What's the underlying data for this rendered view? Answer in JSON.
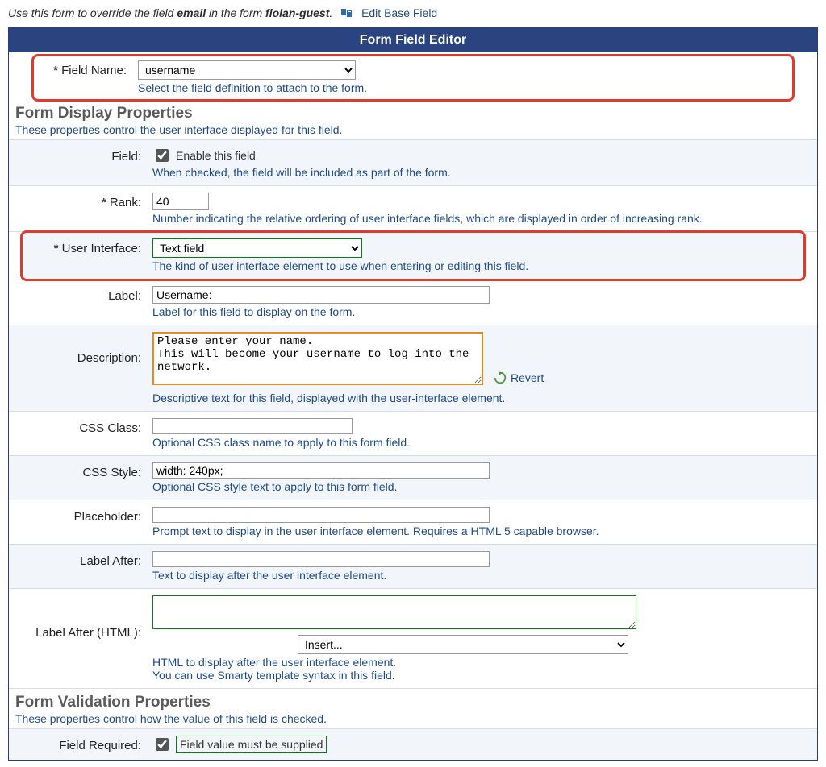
{
  "intro": {
    "prefix": "Use this form to override the field ",
    "fieldName": "email",
    "mid": " in the form ",
    "formName": "flolan-guest",
    "suffix": ".",
    "editBaseLink": "Edit Base Field"
  },
  "panelTitle": "Form Field Editor",
  "fieldName": {
    "label": "Field Name:",
    "value": "username",
    "hint": "Select the field definition to attach to the form."
  },
  "sectionDisplay": {
    "title": "Form Display Properties",
    "sub": "These properties control the user interface displayed for this field."
  },
  "field": {
    "label": "Field:",
    "cbLabel": "Enable this field",
    "checked": true,
    "hint": "When checked, the field will be included as part of the form."
  },
  "rank": {
    "label": "Rank:",
    "value": "40",
    "hint": "Number indicating the relative ordering of user interface fields, which are displayed in order of increasing rank."
  },
  "ui": {
    "label": "User Interface:",
    "value": "Text field",
    "hint": "The kind of user interface element to use when entering or editing this field."
  },
  "labelField": {
    "label": "Label:",
    "value": "Username:",
    "hint": "Label for this field to display on the form."
  },
  "description": {
    "label": "Description:",
    "value": "Please enter your name.\nThis will become your username to log into the network.",
    "revert": "Revert",
    "hint": "Descriptive text for this field, displayed with the user-interface element."
  },
  "cssClass": {
    "label": "CSS Class:",
    "value": "",
    "hint": "Optional CSS class name to apply to this form field."
  },
  "cssStyle": {
    "label": "CSS Style:",
    "value": "width: 240px;",
    "hint": "Optional CSS style text to apply to this form field."
  },
  "placeholder": {
    "label": "Placeholder:",
    "value": "",
    "hint": "Prompt text to display in the user interface element. Requires a HTML 5 capable browser."
  },
  "labelAfter": {
    "label": "Label After:",
    "value": "",
    "hint": "Text to display after the user interface element."
  },
  "labelAfterHtml": {
    "label": "Label After (HTML):",
    "value": "",
    "insertValue": "Insert...",
    "hint1": "HTML to display after the user interface element.",
    "hint2": "You can use Smarty template syntax in this field."
  },
  "sectionValidation": {
    "title": "Form Validation Properties",
    "sub": "These properties control how the value of this field is checked."
  },
  "fieldRequired": {
    "label": "Field Required:",
    "cbLabel": "Field value must be supplied",
    "checked": true
  }
}
